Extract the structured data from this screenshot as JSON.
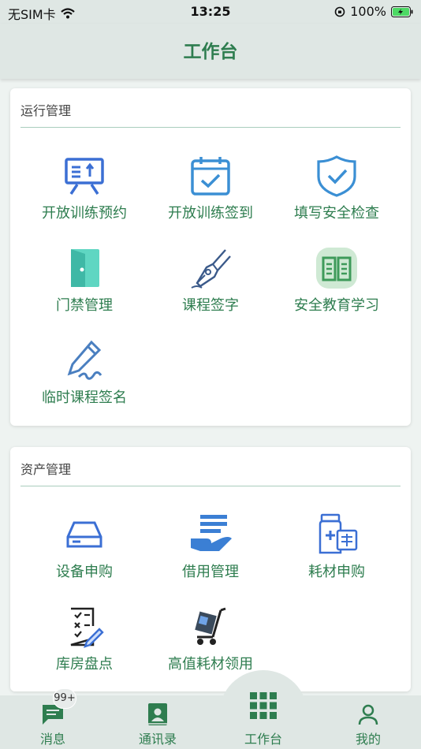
{
  "status": {
    "carrier": "无SIM卡",
    "time": "13:25",
    "battery": "100%"
  },
  "header": {
    "title": "工作台"
  },
  "sections": [
    {
      "title": "运行管理",
      "items": [
        {
          "label": "开放训练预约",
          "icon": "presentation-board-icon"
        },
        {
          "label": "开放训练签到",
          "icon": "calendar-check-icon"
        },
        {
          "label": "填写安全检查",
          "icon": "shield-check-icon"
        },
        {
          "label": "门禁管理",
          "icon": "door-icon"
        },
        {
          "label": "课程签字",
          "icon": "fountain-pen-icon"
        },
        {
          "label": "安全教育学习",
          "icon": "open-book-icon"
        },
        {
          "label": "临时课程签名",
          "icon": "signature-pen-icon"
        }
      ]
    },
    {
      "title": "资产管理",
      "items": [
        {
          "label": "设备申购",
          "icon": "hard-drive-icon"
        },
        {
          "label": "借用管理",
          "icon": "hand-documents-icon"
        },
        {
          "label": "耗材申购",
          "icon": "medicine-bottle-icon"
        },
        {
          "label": "库房盘点",
          "icon": "checklist-icon"
        },
        {
          "label": "高值耗材领用",
          "icon": "hand-truck-icon"
        }
      ]
    }
  ],
  "tabs": [
    {
      "label": "消息",
      "icon": "message-icon",
      "badge": "99+"
    },
    {
      "label": "通讯录",
      "icon": "contacts-icon"
    },
    {
      "label": "工作台",
      "icon": "grid-icon",
      "active": true
    },
    {
      "label": "我的",
      "icon": "person-icon"
    }
  ],
  "colors": {
    "accent": "#2e7d4f",
    "icon_blue": "#3b6fd4",
    "icon_teal": "#5bd3c0",
    "header_bg": "#dfe7e4"
  }
}
